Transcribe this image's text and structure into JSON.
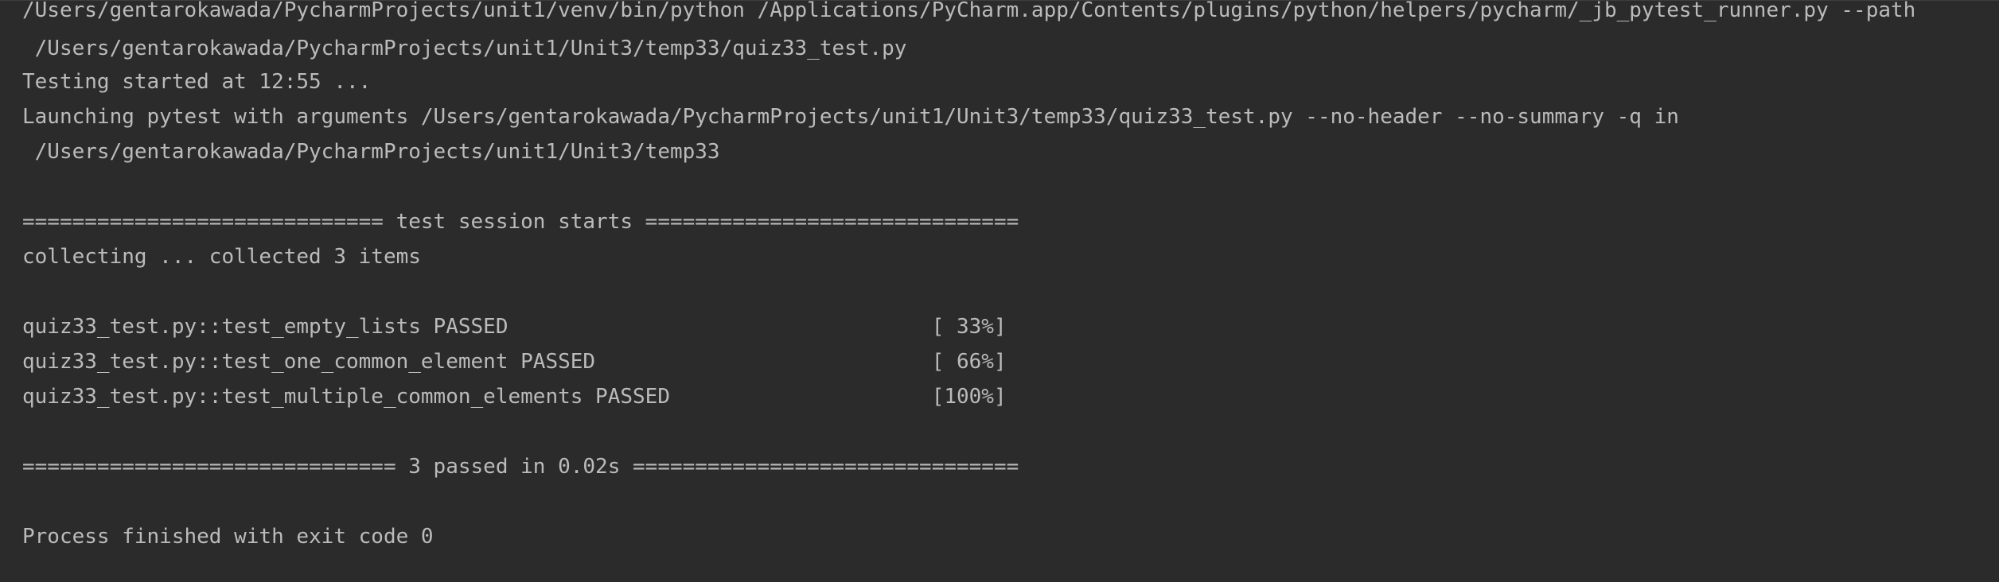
{
  "console": {
    "lines": [
      "/Users/gentarokawada/PycharmProjects/unit1/venv/bin/python /Applications/PyCharm.app/Contents/plugins/python/helpers/pycharm/_jb_pytest_runner.py --path",
      " /Users/gentarokawada/PycharmProjects/unit1/Unit3/temp33/quiz33_test.py",
      "Testing started at 12:55 ...",
      "Launching pytest with arguments /Users/gentarokawada/PycharmProjects/unit1/Unit3/temp33/quiz33_test.py --no-header --no-summary -q in",
      " /Users/gentarokawada/PycharmProjects/unit1/Unit3/temp33",
      "============================= test session starts ==============================",
      "collecting ... collected 3 items",
      "quiz33_test.py::test_empty_lists PASSED                                  [ 33%]",
      "quiz33_test.py::test_one_common_element PASSED                           [ 66%]",
      "quiz33_test.py::test_multiple_common_elements PASSED                     [100%]",
      "============================== 3 passed in 0.02s ===============================",
      "Process finished with exit code 0"
    ]
  },
  "colors": {
    "background": "#2b2b2b",
    "text": "#bbbbbb"
  }
}
